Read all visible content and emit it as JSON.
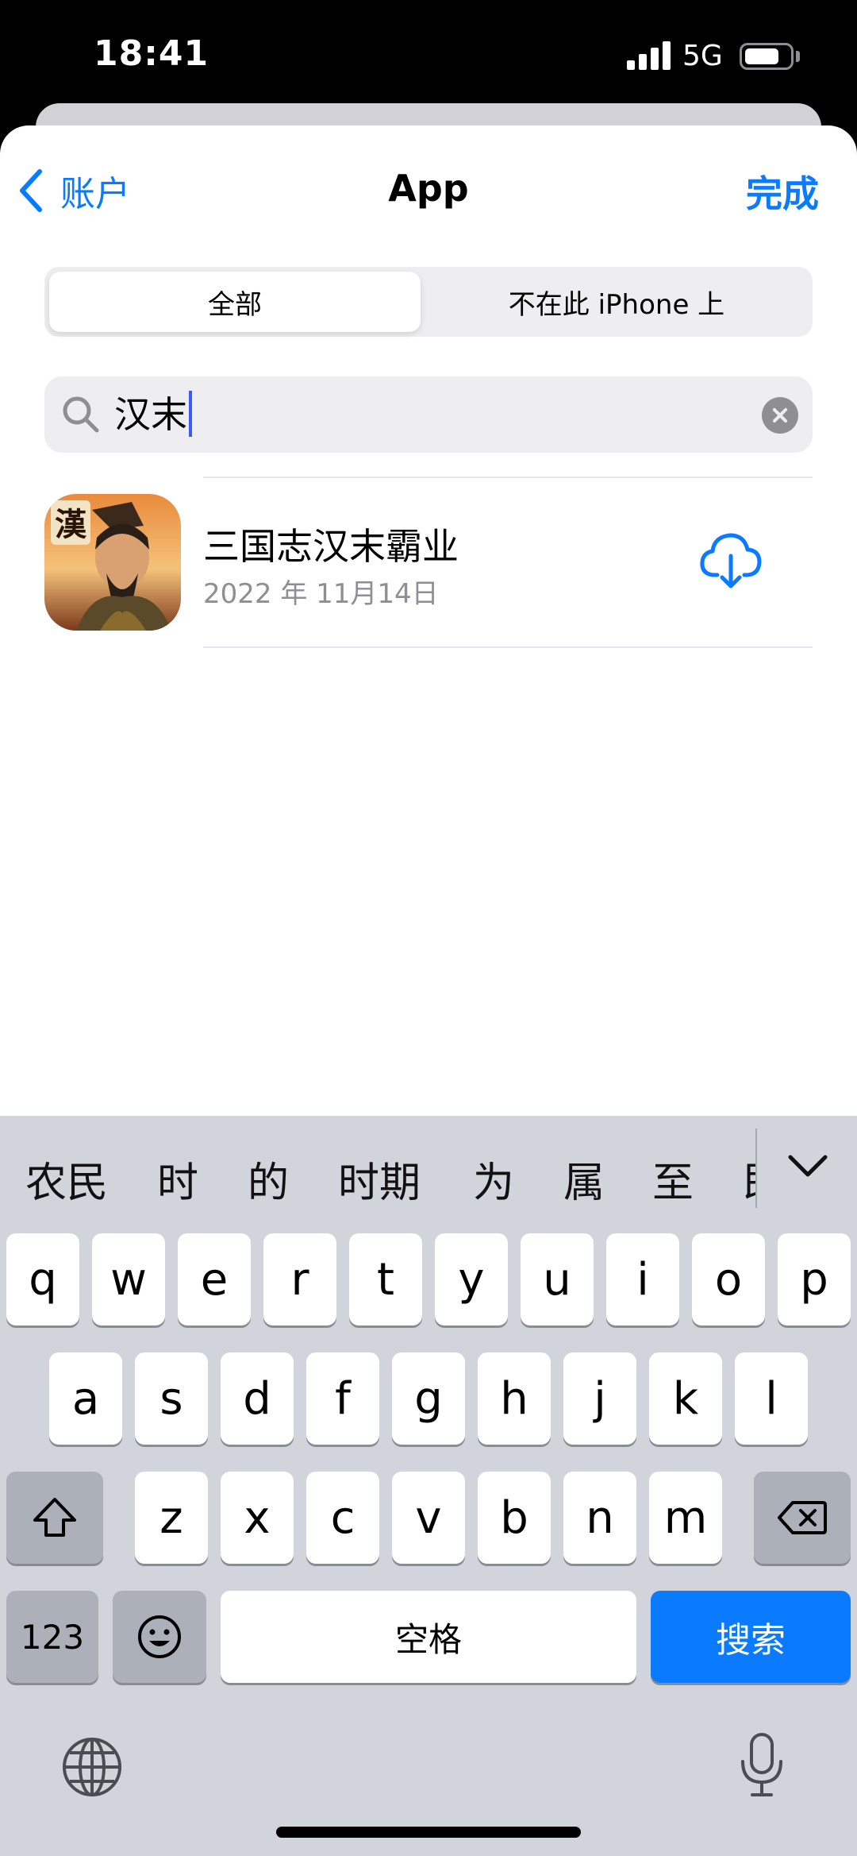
{
  "status_bar": {
    "time": "18:41",
    "network": "5G"
  },
  "nav": {
    "back_label": "账户",
    "title": "App",
    "done_label": "完成"
  },
  "segments": {
    "all": "全部",
    "not_on_device": "不在此 iPhone 上"
  },
  "search": {
    "query": "汉末"
  },
  "results": [
    {
      "name": "三国志汉末霸业",
      "date": "2022 年 11月14日",
      "icon_glyph": "漢"
    }
  ],
  "keyboard": {
    "candidates": [
      "农民",
      "时",
      "的",
      "时期",
      "为",
      "属",
      "至",
      "即"
    ],
    "row1": [
      "q",
      "w",
      "e",
      "r",
      "t",
      "y",
      "u",
      "i",
      "o",
      "p"
    ],
    "row2": [
      "a",
      "s",
      "d",
      "f",
      "g",
      "h",
      "j",
      "k",
      "l"
    ],
    "row3": [
      "z",
      "x",
      "c",
      "v",
      "b",
      "n",
      "m"
    ],
    "numbers_label": "123",
    "space_label": "空格",
    "search_label": "搜索"
  },
  "colors": {
    "accent": "#0a7aff",
    "keyboard_bg": "#d1d4da"
  }
}
